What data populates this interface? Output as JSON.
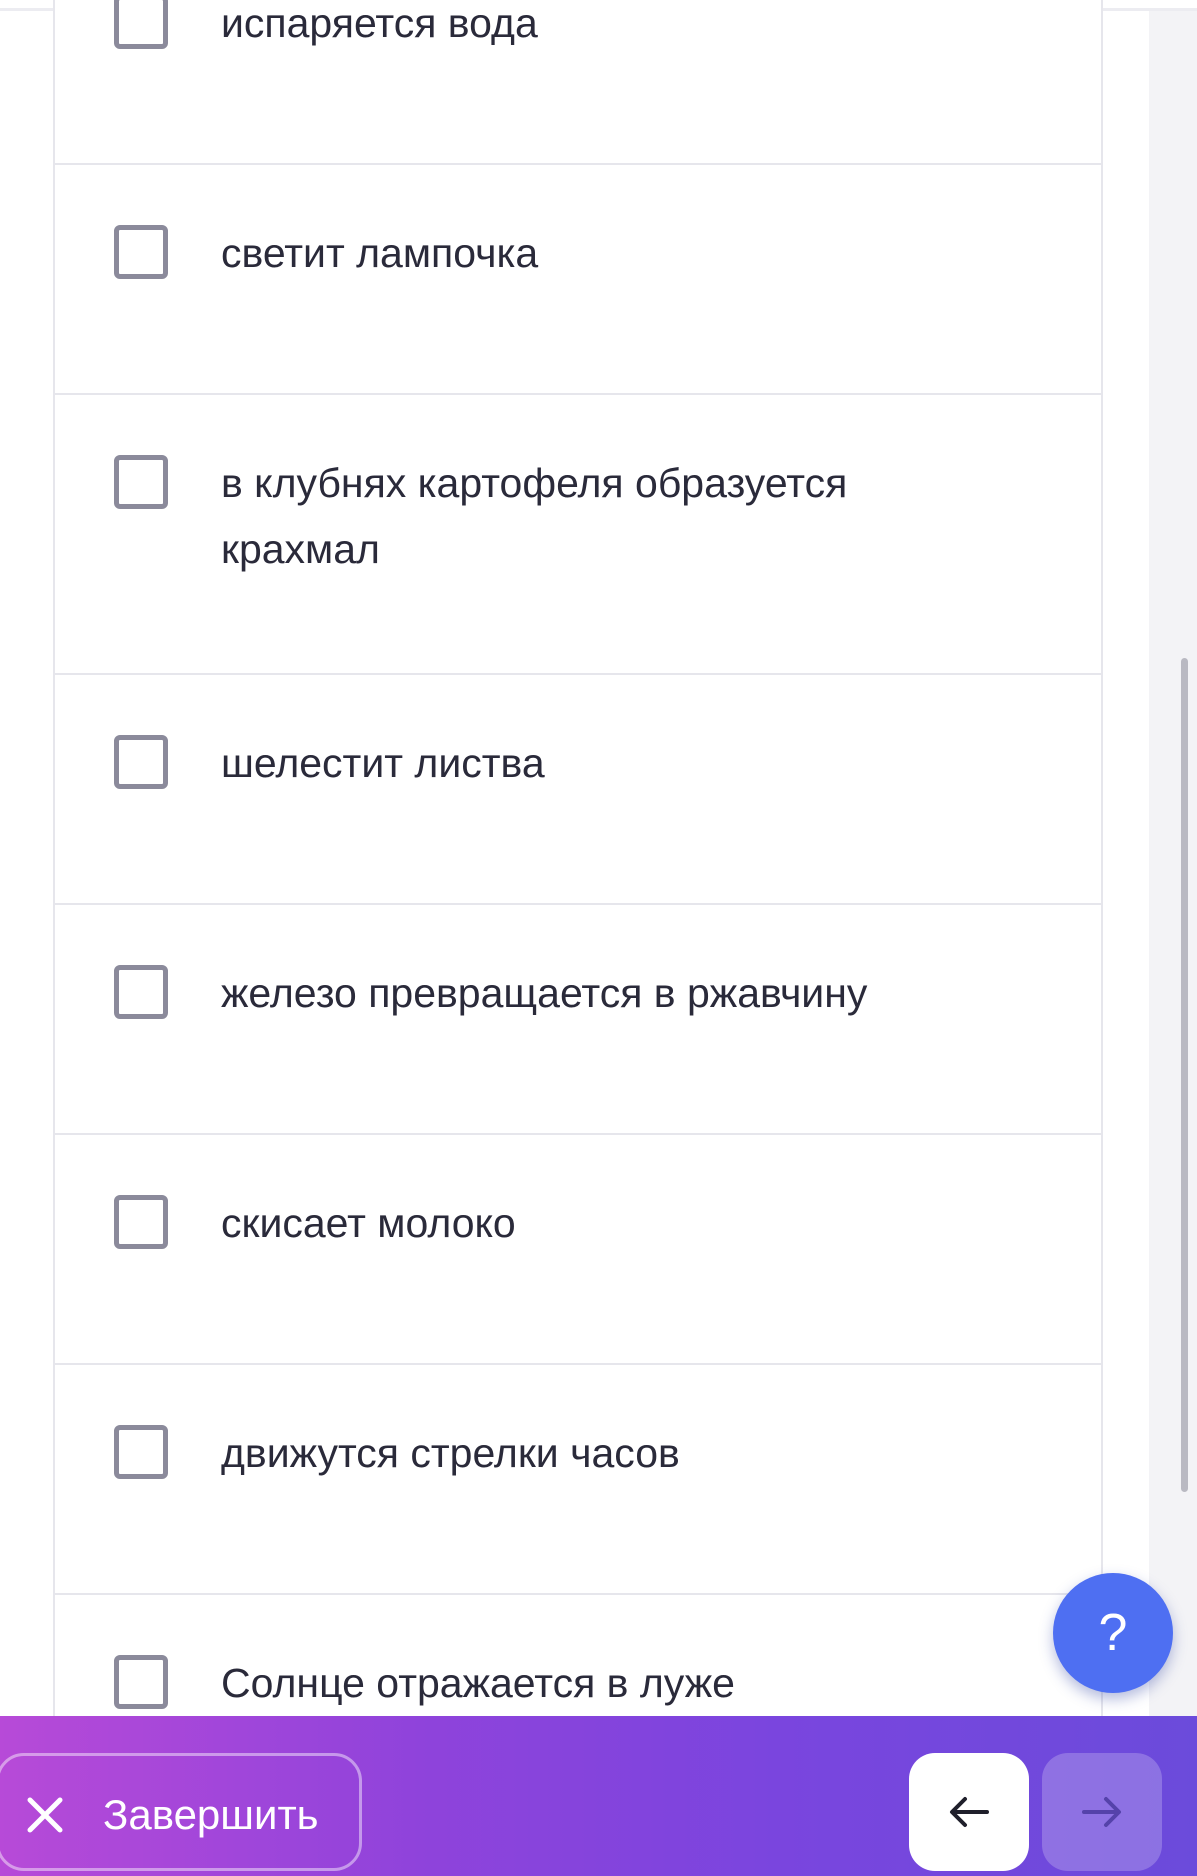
{
  "question": {
    "options": [
      {
        "label": "испаряется вода",
        "checked": false
      },
      {
        "label": "светит лампочка",
        "checked": false
      },
      {
        "label": "в клубнях картофеля образуется крахмал",
        "checked": false
      },
      {
        "label": "шелестит листва",
        "checked": false
      },
      {
        "label": "железо превращается в ржавчину",
        "checked": false
      },
      {
        "label": "скисает молоко",
        "checked": false
      },
      {
        "label": "движутся стрелки часов",
        "checked": false
      },
      {
        "label": "Солнце отражается в луже",
        "checked": false
      }
    ]
  },
  "help": {
    "label": "?",
    "color": "#4e6ff2"
  },
  "footer": {
    "finish_label": "Завершить",
    "back_icon": "arrow-left-icon",
    "forward_icon": "arrow-right-icon",
    "close_icon": "close-icon",
    "gradient_start": "#b74ad8",
    "gradient_end": "#6b4bdb"
  }
}
